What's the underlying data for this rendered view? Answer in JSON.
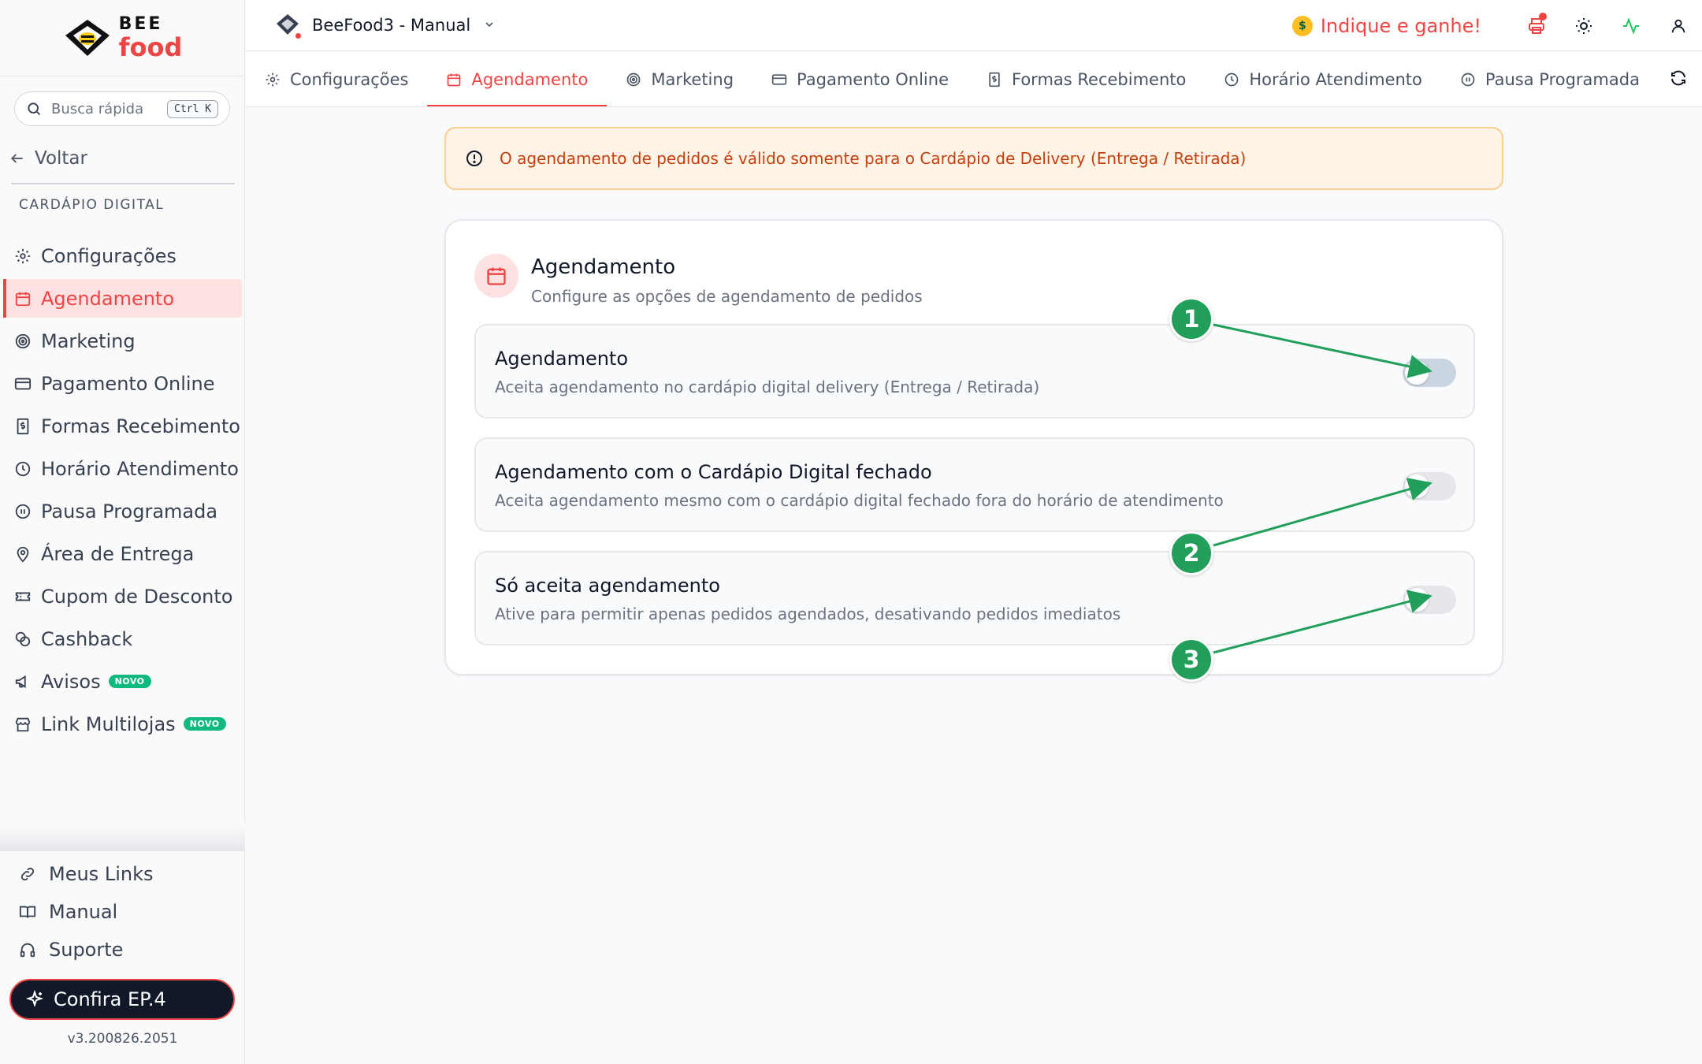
{
  "brand": {
    "logo_top": "BEE",
    "logo_bottom": "food"
  },
  "sidebar": {
    "search_placeholder": "Busca rápida",
    "search_shortcut": "Ctrl K",
    "back_label": "Voltar",
    "section_label": "CARDÁPIO DIGITAL",
    "items": [
      {
        "label": "Configurações",
        "icon": "gear-icon"
      },
      {
        "label": "Agendamento",
        "icon": "calendar-icon",
        "active": true
      },
      {
        "label": "Marketing",
        "icon": "target-icon"
      },
      {
        "label": "Pagamento Online",
        "icon": "credit-card-icon"
      },
      {
        "label": "Formas Recebimento",
        "icon": "receipt-icon"
      },
      {
        "label": "Horário Atendimento",
        "icon": "clock-icon"
      },
      {
        "label": "Pausa Programada",
        "icon": "pause-icon"
      },
      {
        "label": "Área de Entrega",
        "icon": "map-pin-icon"
      },
      {
        "label": "Cupom de Desconto",
        "icon": "ticket-icon"
      },
      {
        "label": "Cashback",
        "icon": "coins-icon"
      },
      {
        "label": "Avisos",
        "icon": "megaphone-icon",
        "badge": "NOVO"
      },
      {
        "label": "Link Multilojas",
        "icon": "store-icon",
        "badge": "NOVO"
      }
    ],
    "bottom_links": [
      {
        "label": "Meus Links",
        "icon": "link-icon"
      },
      {
        "label": "Manual",
        "icon": "book-icon"
      },
      {
        "label": "Suporte",
        "icon": "headphones-icon"
      }
    ],
    "cta_label": "Confira EP.4",
    "version": "v3.200826.2051"
  },
  "topbar": {
    "store_name": "BeeFood3 - Manual",
    "referral_label": "Indique e ganhe!"
  },
  "tabs": [
    {
      "label": "Configurações",
      "icon": "gear-icon"
    },
    {
      "label": "Agendamento",
      "icon": "calendar-icon",
      "active": true
    },
    {
      "label": "Marketing",
      "icon": "target-icon"
    },
    {
      "label": "Pagamento Online",
      "icon": "credit-card-icon"
    },
    {
      "label": "Formas Recebimento",
      "icon": "receipt-icon"
    },
    {
      "label": "Horário Atendimento",
      "icon": "clock-icon"
    },
    {
      "label": "Pausa Programada",
      "icon": "pause-icon"
    }
  ],
  "alert": {
    "text": "O agendamento de pedidos é válido somente para o Cardápio de Delivery (Entrega / Retirada)"
  },
  "card": {
    "title": "Agendamento",
    "subtitle": "Configure as opções de agendamento de pedidos",
    "options": [
      {
        "title": "Agendamento",
        "description": "Aceita agendamento no cardápio digital delivery (Entrega / Retirada)",
        "enabled": false
      },
      {
        "title": "Agendamento com o Cardápio Digital fechado",
        "description": "Aceita agendamento mesmo com o cardápio digital fechado fora do horário de atendimento",
        "enabled": false
      },
      {
        "title": "Só aceita agendamento",
        "description": "Ative para permitir apenas pedidos agendados, desativando pedidos imediatos",
        "enabled": false
      }
    ]
  },
  "annotations": [
    "1",
    "2",
    "3"
  ],
  "colors": {
    "accent": "#ef4444",
    "annotation": "#22a05b",
    "alert_text": "#c2410c",
    "badge": "#10b981"
  }
}
